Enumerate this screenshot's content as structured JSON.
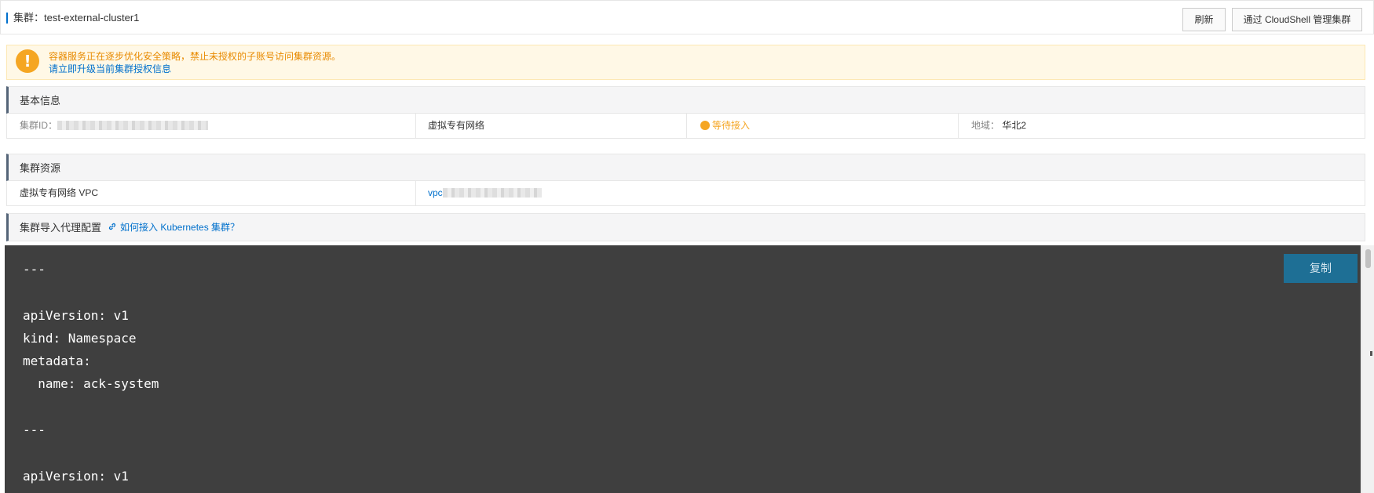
{
  "header": {
    "title": "集群：test-external-cluster1",
    "refresh_label": "刷新",
    "cloudshell_label": "通过 CloudShell 管理集群"
  },
  "notice": {
    "text": "容器服务正在逐步优化安全策略，禁止未授权的子账号访问集群资源。",
    "link": "请立即升级当前集群授权信息",
    "icon": "exclamation-icon"
  },
  "basic_info": {
    "title": "基本信息",
    "cluster_id_label": "集群ID：",
    "network_type": "虚拟专有网络",
    "status": "等待接入",
    "region_label": "地域：",
    "region_value": "华北2"
  },
  "cluster_resources": {
    "title": "集群资源",
    "vpc_label": "虚拟专有网络 VPC",
    "vpc_value_prefix": "vpc"
  },
  "agent_config": {
    "title": "集群导入代理配置",
    "help_link": "如何接入 Kubernetes 集群？",
    "copy_label": "复制",
    "code": "---\n\napiVersion: v1\nkind: Namespace\nmetadata:\n  name: ack-system\n\n---\n\napiVersion: v1"
  },
  "colors": {
    "accent": "#0070cc",
    "warning": "#f5a623",
    "code_bg": "#3f3f3f",
    "copy_button": "#1e6f95"
  }
}
